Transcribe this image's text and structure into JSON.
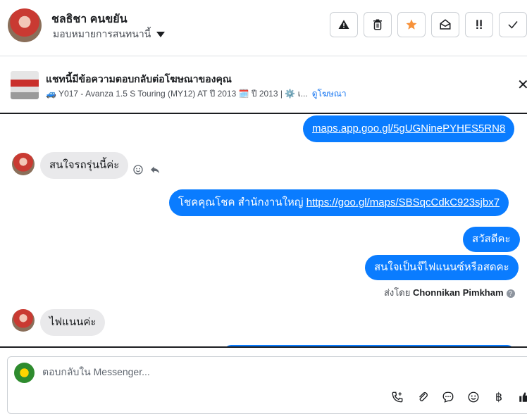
{
  "header": {
    "contact_name": "ชลธิชา คนขยัน",
    "assign_label": "มอบหมายการสนทนานี้"
  },
  "actions": [
    {
      "name": "report-spam-button",
      "icon": "warning-icon"
    },
    {
      "name": "delete-button",
      "icon": "trash-icon"
    },
    {
      "name": "star-button",
      "icon": "star-icon",
      "color": "#f7923a"
    },
    {
      "name": "mark-unread-button",
      "icon": "envelope-open-icon"
    },
    {
      "name": "follow-up-button",
      "icon": "double-exclamation-icon"
    },
    {
      "name": "mark-done-button",
      "icon": "check-icon"
    }
  ],
  "ad": {
    "title": "แชทนี้มีข้อความตอบกลับต่อโฆษณาของคุณ",
    "subtitle": "🚙 Y017 - Avanza 1.5 S Touring (MY12) AT ปี 2013 🗓️ ปี 2013 | ⚙️ เ...",
    "view_ad": "ดูโฆษณา"
  },
  "messages": {
    "m1_link": "maps.app.goo.gl/5gUGNinePYHES5RN8",
    "m2_text": "สนใจรถรุ่นนี้ค่ะ",
    "m3_text": "โชคคุณโชค สำนักงานใหญ่ ",
    "m3_link": "https://goo.gl/maps/SBSqcCdkC923sjbx7",
    "m4_text": "สวัสดีคะ",
    "m5_text": "สนใจเป็นจ๊ไฟแนนซ์หรือสดคะ",
    "sent_by_label": "ส่งโดย",
    "sent_by_name": "Chonnikan Pimkham",
    "m6_text": "ไฟแนนค่ะ"
  },
  "composer": {
    "placeholder": "ตอบกลับใน Messenger..."
  },
  "colors": {
    "outgoing": "#0a7cff",
    "incoming": "#e9e9eb",
    "link": "#1877f2"
  }
}
